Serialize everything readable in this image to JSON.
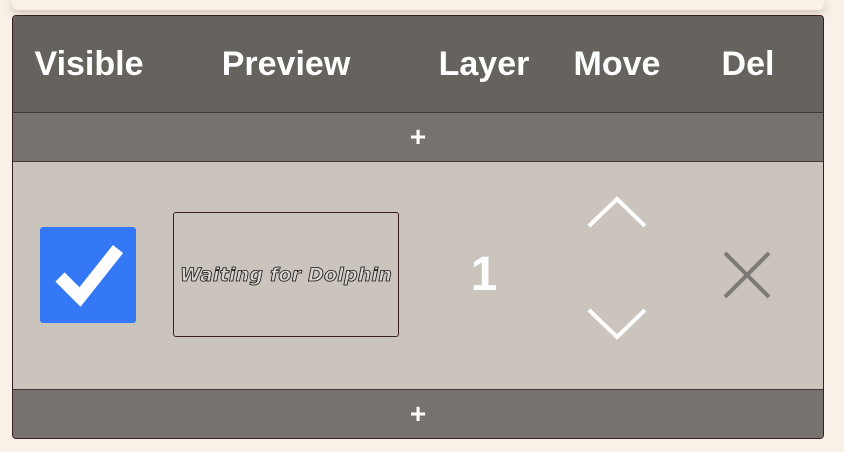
{
  "header": {
    "visible": "Visible",
    "preview": "Preview",
    "layer": "Layer",
    "move": "Move",
    "del": "Del"
  },
  "add_row_label": "+",
  "layers": [
    {
      "visible": true,
      "preview_text": "Waiting for Dolphin",
      "layer_number": "1"
    }
  ],
  "icons": {
    "checkbox": "checkmark-icon",
    "move_up": "chevron-up-icon",
    "move_down": "chevron-down-icon",
    "delete": "close-icon"
  },
  "colors": {
    "page_bg": "#f9f1e7",
    "header_bg": "#66625d",
    "add_row_bg": "#77726d",
    "row_bg": "#cbc4bd",
    "checkbox_bg": "#3478f6",
    "border": "#3b1e22"
  }
}
